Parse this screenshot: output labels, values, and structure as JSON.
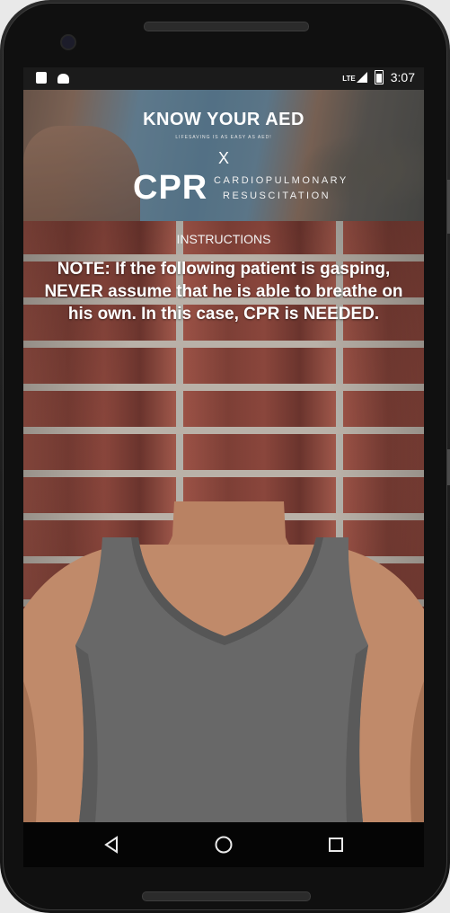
{
  "status_bar": {
    "time": "3:07",
    "network": "LTE",
    "icons": [
      "sim-card-icon",
      "android-icon",
      "lte-signal-icon",
      "battery-icon"
    ]
  },
  "banner": {
    "title": "KNOW YOUR AED",
    "tagline": "LIFESAVING IS AS EASY AS AED!",
    "separator": "X",
    "cpr": "CPR",
    "cpr_line1": "CARDIOPULMONARY",
    "cpr_line2": "RESUSCITATION"
  },
  "main": {
    "section_label": "INSTRUCTIONS",
    "note": "NOTE: If the following patient is gasping, NEVER assume that he is able to breathe on his own. In this case, CPR is NEEDED."
  },
  "nav_bar": {
    "buttons": [
      "back-icon",
      "home-icon",
      "recents-icon"
    ]
  },
  "colors": {
    "status_bar": "#1b1b1b",
    "brick": "#8a463c",
    "mortar": "#b9b1a8",
    "tank_top": "#6a6a6a",
    "skin": "#c08a6a",
    "nav_bar": "#050505"
  }
}
